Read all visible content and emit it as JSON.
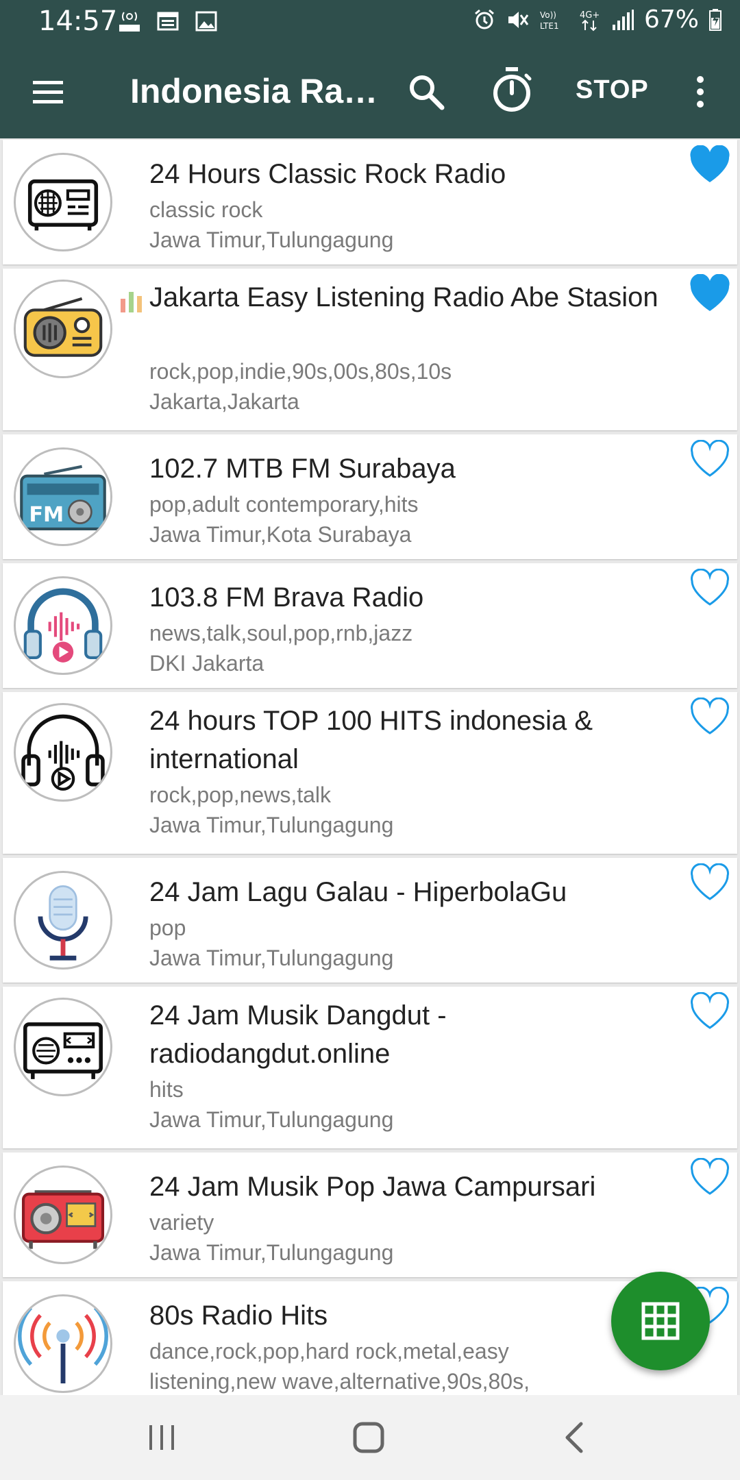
{
  "status_bar": {
    "time": "14:57",
    "battery_percent": "67%",
    "network_labels": [
      "Vo)) LTE1",
      "4G+"
    ]
  },
  "toolbar": {
    "title": "Indonesia Ra…",
    "stop_label": "STOP",
    "background_color": "#2f4f4c"
  },
  "stations": [
    {
      "title": "24 Hours Classic Rock Radio",
      "genres": "classic rock",
      "location": "Jawa Timur,Tulungagung",
      "favorite": true,
      "logo_icon": "vintage-radio-icon"
    },
    {
      "title": "Jakarta Easy Listening Radio Abe Stasion",
      "genres": "rock,pop,indie,90s,00s,80s,10s",
      "location": "Jakarta,Jakarta",
      "favorite": true,
      "now_playing": true,
      "logo_icon": "retro-radio-icon"
    },
    {
      "title": "102.7 MTB FM Surabaya",
      "genres": "pop,adult contemporary,hits",
      "location": "Jawa Timur,Kota Surabaya",
      "favorite": false,
      "logo_icon": "fm-radio-icon"
    },
    {
      "title": "103.8 FM Brava Radio",
      "genres": "news,talk,soul,pop,rnb,jazz",
      "location": "DKI Jakarta",
      "favorite": false,
      "logo_icon": "headphones-icon"
    },
    {
      "title": "24 hours TOP 100 HITS indonesia & international",
      "genres": "rock,pop,news,talk",
      "location": "Jawa Timur,Tulungagung",
      "favorite": false,
      "logo_icon": "headphones-outline-icon"
    },
    {
      "title": "24 Jam Lagu Galau - HiperbolaGu",
      "genres": "pop",
      "location": "Jawa Timur,Tulungagung",
      "favorite": false,
      "logo_icon": "microphone-icon"
    },
    {
      "title": "24 Jam Musik Dangdut - radiodangdut.online",
      "genres": "hits",
      "location": "Jawa Timur,Tulungagung",
      "favorite": false,
      "logo_icon": "radio-outline-icon"
    },
    {
      "title": "24 Jam Musik Pop Jawa Campursari",
      "genres": "variety",
      "location": "Jawa Timur,Tulungagung",
      "favorite": false,
      "logo_icon": "red-radio-icon"
    },
    {
      "title": "80s Radio Hits",
      "genres": "dance,rock,pop,hard rock,metal,easy",
      "location": "listening,new wave,alternative,90s,80s,",
      "favorite": false,
      "logo_icon": "broadcast-antenna-icon"
    }
  ],
  "colors": {
    "heart": "#1a9be8",
    "fab": "#1e8e2c"
  }
}
